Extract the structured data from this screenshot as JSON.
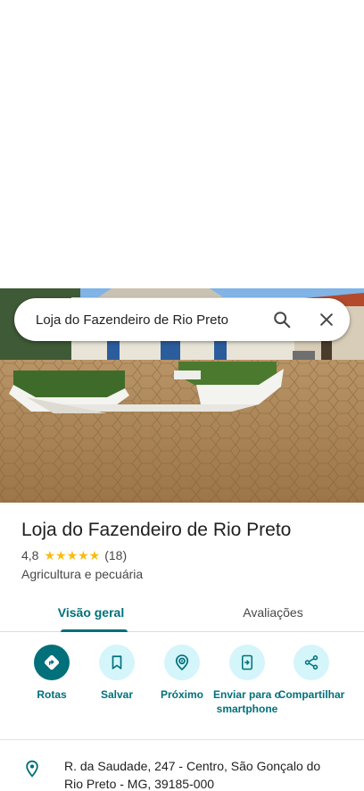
{
  "search": {
    "query": "Loja do Fazendeiro de Rio Preto"
  },
  "place": {
    "name": "Loja do Fazendeiro de Rio Preto",
    "rating": "4,8",
    "stars": "★★★★★",
    "review_count": "(18)",
    "category": "Agricultura e pecuária"
  },
  "tabs": [
    {
      "label": "Visão geral",
      "active": true
    },
    {
      "label": "Avaliações",
      "active": false
    }
  ],
  "actions": [
    {
      "label": "Rotas",
      "icon": "directions-icon"
    },
    {
      "label": "Salvar",
      "icon": "bookmark-icon"
    },
    {
      "label": "Próximo",
      "icon": "nearby-icon"
    },
    {
      "label": "Enviar para o smartphone",
      "icon": "send-to-phone-icon"
    },
    {
      "label": "Compartilhar",
      "icon": "share-icon"
    }
  ],
  "address": "R. da Saudade, 247 - Centro, São Gonçalo do Rio Preto - MG, 39185-000",
  "colors": {
    "accent": "#00707a",
    "accent_light": "#d4f5fa",
    "star": "#fbbc04"
  }
}
